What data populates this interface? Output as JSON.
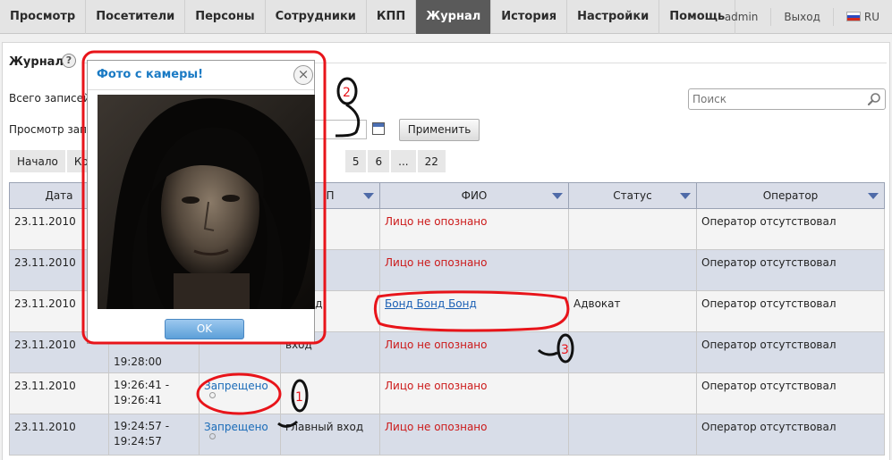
{
  "nav": {
    "items": [
      {
        "label": "Просмотр",
        "active": false
      },
      {
        "label": "Посетители",
        "active": false
      },
      {
        "label": "Персоны",
        "active": false
      },
      {
        "label": "Сотрудники",
        "active": false
      },
      {
        "label": "КПП",
        "active": false
      },
      {
        "label": "Журнал",
        "active": true
      },
      {
        "label": "История",
        "active": false
      },
      {
        "label": "Настройки",
        "active": false
      },
      {
        "label": "Помощь",
        "active": false
      }
    ],
    "user": "admin",
    "logout": "Выход",
    "lang": "RU"
  },
  "page": {
    "title": "Журнал",
    "help": "?",
    "total_label": "Всего записей",
    "view_label": "Просмотр запи",
    "apply": "Применить"
  },
  "search": {
    "placeholder": "Поиск"
  },
  "pager": [
    "Начало",
    "Ко",
    "5",
    "6",
    "...",
    "22"
  ],
  "table": {
    "headers": [
      "Дата",
      "",
      "П",
      "ФИО",
      "Статус",
      "Оператор"
    ],
    "rows": [
      {
        "date": "23.11.2010",
        "time": "",
        "event": "",
        "kpp": "",
        "fio": "Лицо не опознано",
        "status": "",
        "operator": "Оператор отсутствовал"
      },
      {
        "date": "23.11.2010",
        "time": "",
        "event": "",
        "kpp": "",
        "fio": "Лицо не опознано",
        "status": "",
        "operator": "Оператор отсутствовал"
      },
      {
        "date": "23.11.2010",
        "time": "",
        "event": "",
        "kpp": "й вход",
        "fio": "Бонд Бонд Бонд",
        "status": "Адвокат",
        "operator": "Оператор отсутствовал"
      },
      {
        "date": "23.11.2010",
        "time": "19:28:00",
        "event": "",
        "kpp": "вход",
        "fio": "Лицо не опознано",
        "status": "",
        "operator": "Оператор отсутствовал"
      },
      {
        "date": "23.11.2010",
        "time": "19:26:41 -\n19:26:41",
        "event": "Запрещено",
        "kpp": "",
        "fio": "Лицо не опознано",
        "status": "",
        "operator": "Оператор отсутствовал"
      },
      {
        "date": "23.11.2010",
        "time": "19:24:57 -\n19:24:57",
        "event": "Запрещено",
        "kpp": "главный вход",
        "fio": "Лицо не опознано",
        "status": "",
        "operator": "Оператор отсутствовал"
      }
    ]
  },
  "modal": {
    "title": "Фото с камеры!",
    "close": "×",
    "ok": "OK"
  },
  "annotations": [
    "1",
    "2",
    "3"
  ],
  "colors": {
    "accent": "#1a7ac4",
    "alert": "#cc1a1a",
    "annotation": "#e8141a"
  }
}
